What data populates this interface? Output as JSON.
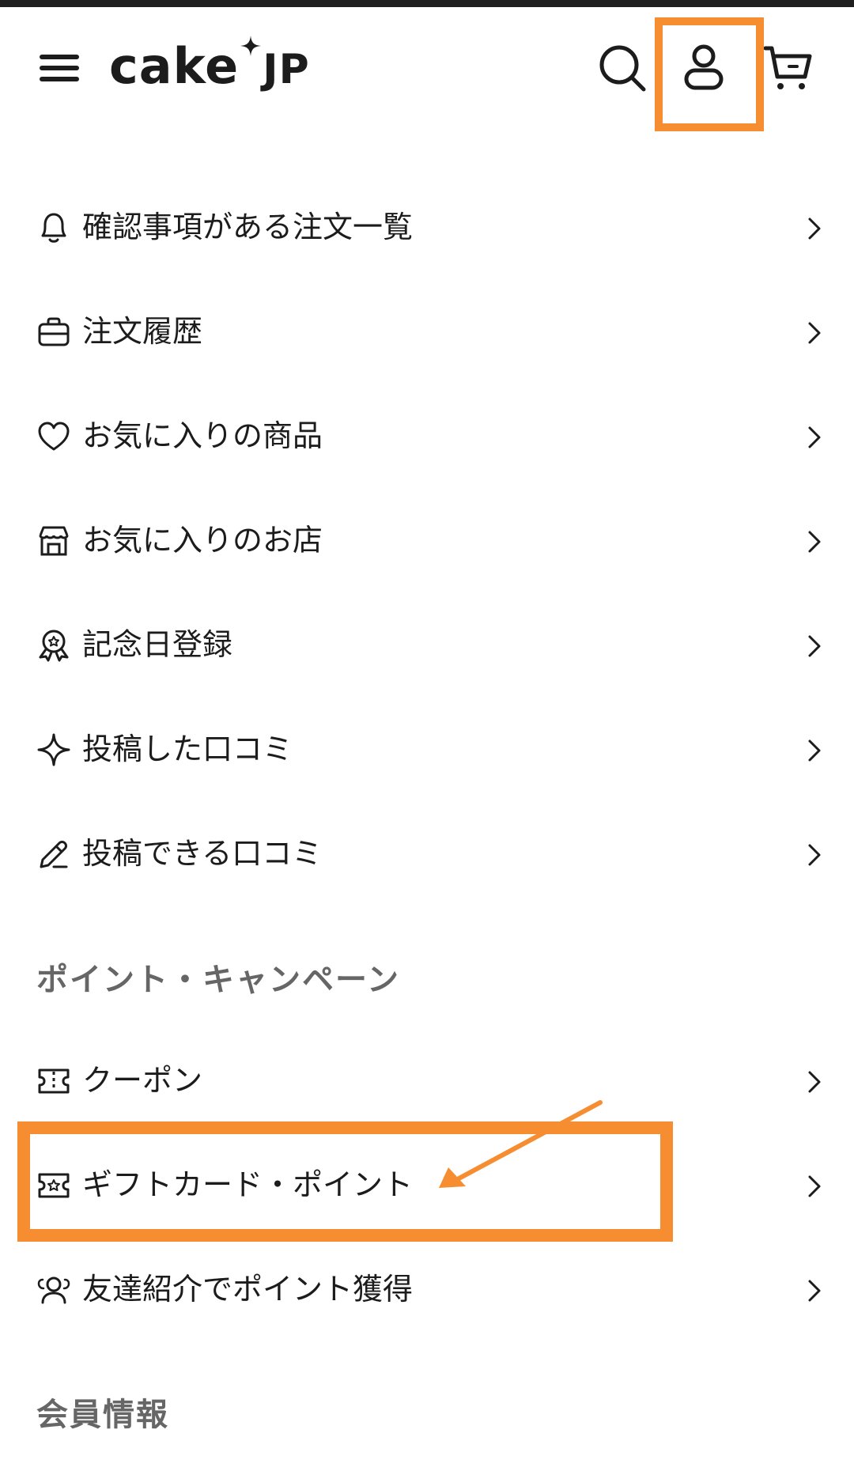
{
  "header": {
    "logo_main": "cake",
    "logo_suffix": "JP",
    "icons": [
      "hamburger-menu-icon",
      "search-icon",
      "user-icon",
      "cart-icon"
    ]
  },
  "menu": {
    "items": [
      {
        "label": "確認事項がある注文一覧",
        "icon": "bell-icon"
      },
      {
        "label": "注文履歴",
        "icon": "briefcase-icon"
      },
      {
        "label": "お気に入りの商品",
        "icon": "heart-icon"
      },
      {
        "label": "お気に入りのお店",
        "icon": "shop-icon"
      },
      {
        "label": "記念日登録",
        "icon": "award-icon"
      },
      {
        "label": "投稿した口コミ",
        "icon": "sparkle-icon"
      },
      {
        "label": "投稿できる口コミ",
        "icon": "pencil-icon"
      }
    ]
  },
  "points_section": {
    "title": "ポイント・キャンペーン",
    "items": [
      {
        "label": "クーポン",
        "icon": "ticket-icon"
      },
      {
        "label": "ギフトカード・ポイント",
        "icon": "gift-card-icon"
      },
      {
        "label": "友達紹介でポイント獲得",
        "icon": "users-icon"
      }
    ]
  },
  "member_section": {
    "title": "会員情報"
  },
  "colors": {
    "highlight": "#f68d31",
    "text": "#1c1c1c",
    "section_title": "#666666"
  }
}
